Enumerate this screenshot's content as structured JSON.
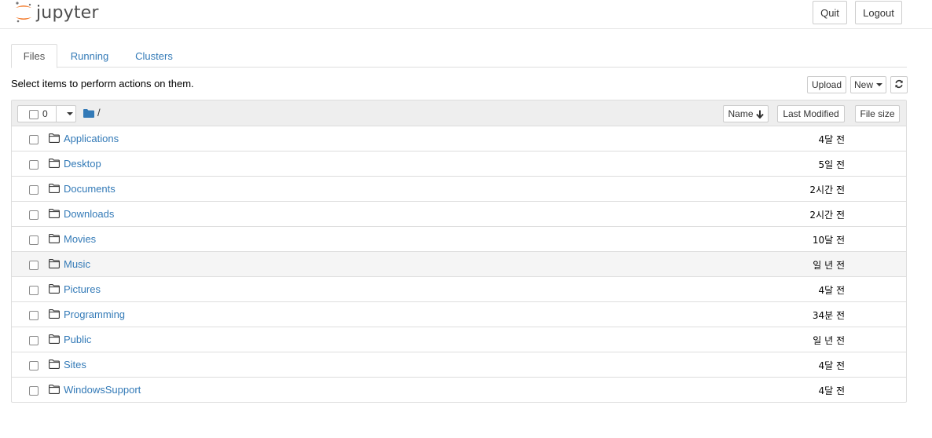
{
  "header": {
    "logo_text": "jupyter",
    "quit_label": "Quit",
    "logout_label": "Logout"
  },
  "tabs": [
    {
      "label": "Files",
      "active": true
    },
    {
      "label": "Running",
      "active": false
    },
    {
      "label": "Clusters",
      "active": false
    }
  ],
  "toolbar": {
    "hint": "Select items to perform actions on them.",
    "upload_label": "Upload",
    "new_label": "New",
    "refresh_icon": "refresh-icon"
  },
  "list_header": {
    "selected_count": "0",
    "breadcrumb": "/",
    "sort_name_label": "Name",
    "last_modified_label": "Last Modified",
    "file_size_label": "File size"
  },
  "items": [
    {
      "name": "Applications",
      "modified": "4달 전"
    },
    {
      "name": "Desktop",
      "modified": "5일 전"
    },
    {
      "name": "Documents",
      "modified": "2시간 전"
    },
    {
      "name": "Downloads",
      "modified": "2시간 전"
    },
    {
      "name": "Movies",
      "modified": "10달 전"
    },
    {
      "name": "Music",
      "modified": "일 년 전"
    },
    {
      "name": "Pictures",
      "modified": "4달 전"
    },
    {
      "name": "Programming",
      "modified": "34분 전"
    },
    {
      "name": "Public",
      "modified": "일 년 전"
    },
    {
      "name": "Sites",
      "modified": "4달 전"
    },
    {
      "name": "WindowsSupport",
      "modified": "4달 전"
    }
  ],
  "colors": {
    "link": "#337ab7",
    "logo_orange": "#f37726",
    "header_bg": "#eeeeee"
  }
}
